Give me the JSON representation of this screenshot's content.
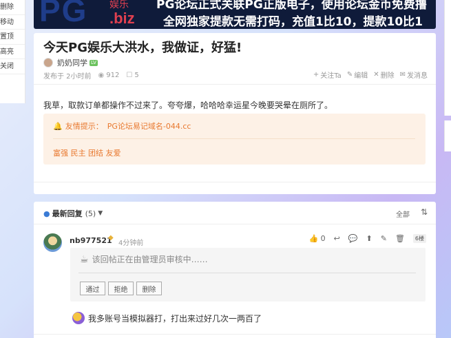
{
  "left_menu": {
    "items": [
      "删除",
      "移动",
      "置顶",
      "高亮",
      "关闭"
    ]
  },
  "banner": {
    "logo": "PG",
    "logo_sub1": "娱乐",
    "logo_sub2": ".biz",
    "line1": "PG论坛正式关联PG正版电子，使用论坛金币免费撸",
    "line2": "全网独家提款无需打码，充值1比10，提款10比1"
  },
  "post": {
    "title": "今天PG娱乐大洪水，我做证，好猛!",
    "author": "奶奶同学",
    "level_badge": "LV",
    "posted_time": "发布于 2小时前",
    "views": "912",
    "comments": "5",
    "actions": {
      "follow": "关注Ta",
      "edit": "编辑",
      "delete": "删除",
      "message": "发消息"
    },
    "body": "我草，取款订单都操作不过来了。夸夸爆，哈哈哈幸运星今晚要哭晕在厕所了。",
    "notice": {
      "tip_label": "友情提示：",
      "tip_text": "PG论坛易记域名-044.cc",
      "tags": "富强 民主 团结 友爱"
    }
  },
  "replies": {
    "header_title": "最新回复",
    "count": "(5)",
    "sort_label": "全部",
    "reply": {
      "user": "nb977521",
      "time": "4分钟前",
      "likes": "0",
      "floor": "6楼",
      "review_message": "该回帖正在由管理员审核中……",
      "buttons": {
        "approve": "通过",
        "reject": "拒绝",
        "delete": "删除"
      }
    },
    "sub_reply_text": "我多账号当模拟器打，打出来过好几次一两百了"
  },
  "colors": {
    "accent_orange": "#e8782e",
    "notice_bg": "#fdf1e6",
    "link_blue": "#3a7bd5",
    "banner_bg": "#0f1b3a"
  }
}
